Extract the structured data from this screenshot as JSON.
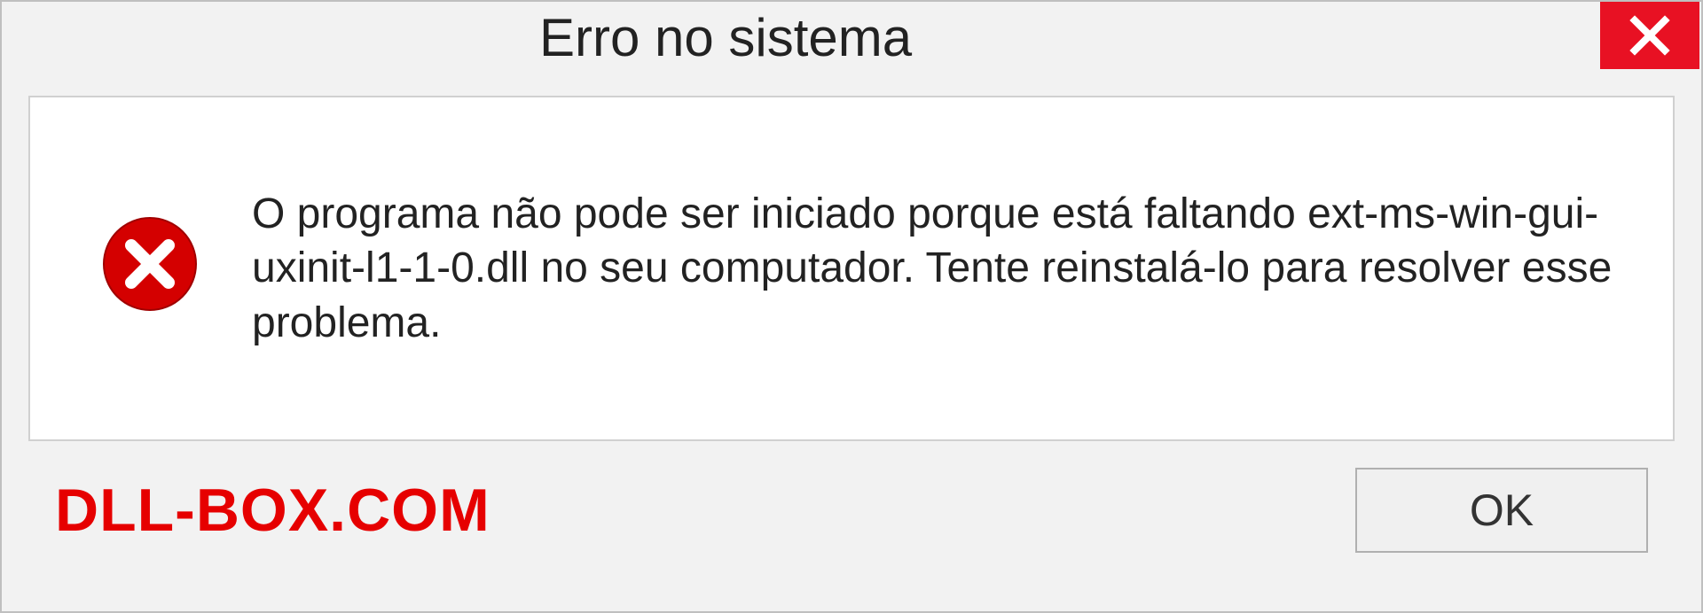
{
  "dialog": {
    "title": "Erro no sistema",
    "message": "O programa não pode ser iniciado porque está faltando ext-ms-win-gui-uxinit-l1-1-0.dll no seu computador. Tente reinstalá-lo para resolver esse problema.",
    "ok_label": "OK"
  },
  "watermark": "DLL-BOX.COM"
}
